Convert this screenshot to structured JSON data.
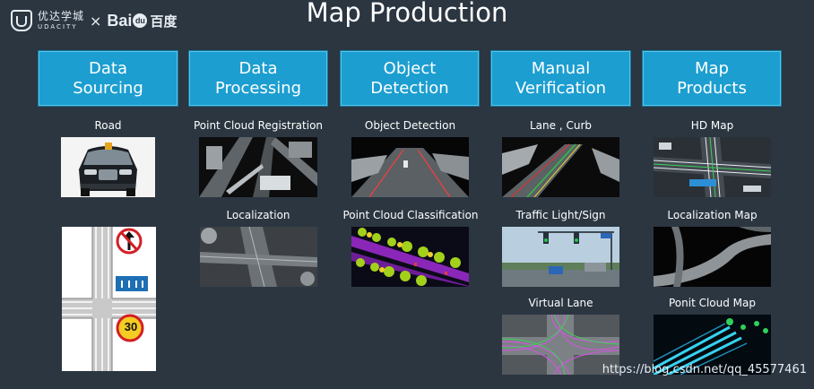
{
  "logos": {
    "udacity_cn": "优达学城",
    "udacity_en": "UDACITY",
    "separator": "×",
    "baidu_prefix": "Bai",
    "baidu_paw": "du",
    "baidu_cn": "百度"
  },
  "title": "Map Production",
  "columns": [
    {
      "line1": "Data",
      "line2": "Sourcing"
    },
    {
      "line1": "Data",
      "line2": "Processing"
    },
    {
      "line1": "Object",
      "line2": "Detection"
    },
    {
      "line1": "Manual",
      "line2": "Verification"
    },
    {
      "line1": "Map",
      "line2": "Products"
    }
  ],
  "captions": {
    "road": "Road",
    "point_cloud_registration": "Point Cloud Registration",
    "localization": "Localization",
    "object_detection": "Object Detection",
    "point_cloud_classification": "Point Cloud Classification",
    "lane_curb": "Lane , Curb",
    "traffic_light_sign": "Traffic Light/Sign",
    "virtual_lane": "Virtual Lane",
    "hd_map": "HD Map",
    "localization_map": "Localization Map",
    "point_cloud_map": "Ponit Cloud Map"
  },
  "sign_speed": "30",
  "watermark": "https://blog.csdn.net/qq_45577461",
  "colors": {
    "background": "#2b3641",
    "header_fill": "#1c9ed0",
    "header_border": "#59c4ea"
  }
}
